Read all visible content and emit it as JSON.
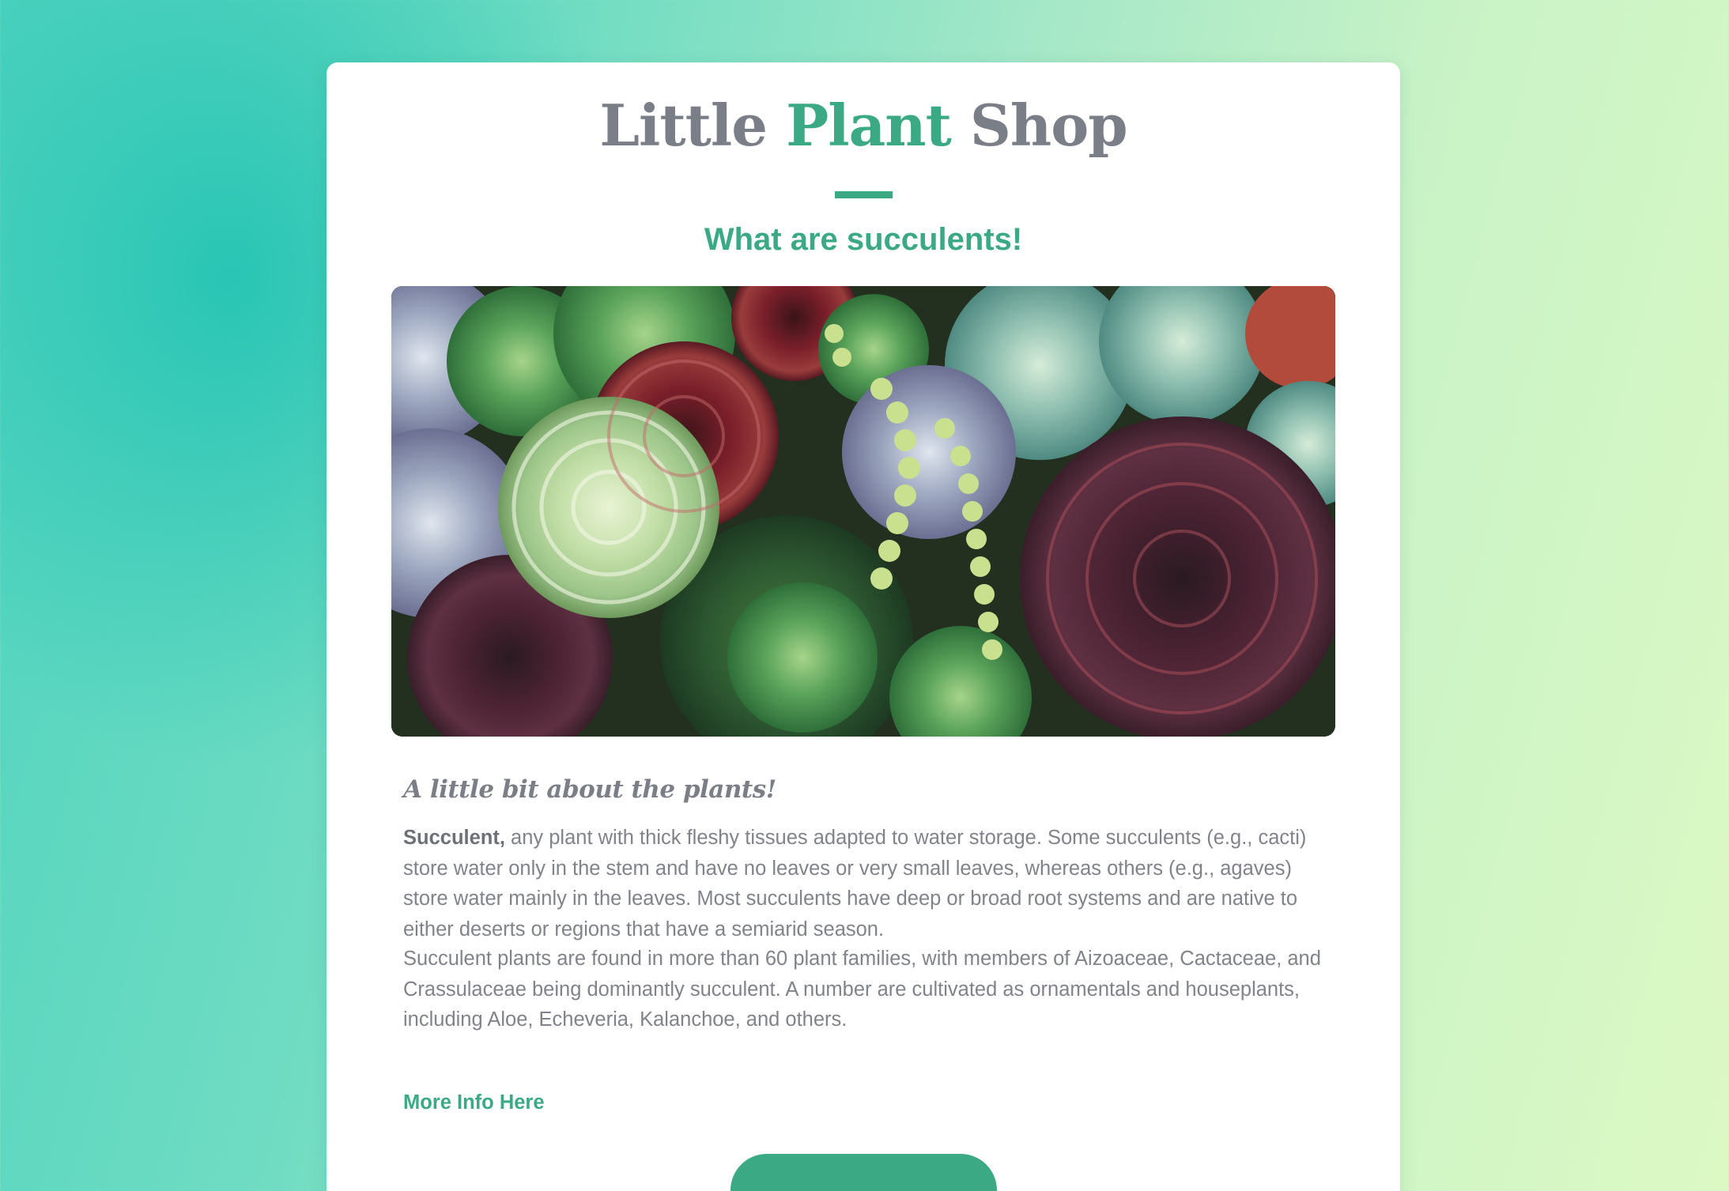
{
  "header": {
    "logo_part1": "Little ",
    "logo_accent": "Plant",
    "logo_part2": " Shop",
    "subtitle": "What are succulents!"
  },
  "hero": {
    "image": "succulents-photo"
  },
  "about": {
    "heading": "A little bit about the plants!",
    "para1_bold": "Succulent,",
    "para1_rest": " any plant with thick fleshy tissues adapted to water storage. Some succulents (e.g., cacti) store water only in the stem and have no leaves or very small leaves, whereas others (e.g., agaves) store water mainly in the leaves. Most succulents have deep or broad root systems and are native to either deserts or regions that have a semiarid season.",
    "para2": "Succulent plants are found in more than 60 plant families, with members of Aizoaceae, Cactaceae, and Crassulaceae being dominantly succulent. A number are cultivated as ornamentals and houseplants, including Aloe, Echeveria, Kalanchoe, and others.",
    "link_label": "More Info Here"
  },
  "colors": {
    "accent": "#3aa984",
    "text": "#808389",
    "logo": "#7a7e86"
  }
}
